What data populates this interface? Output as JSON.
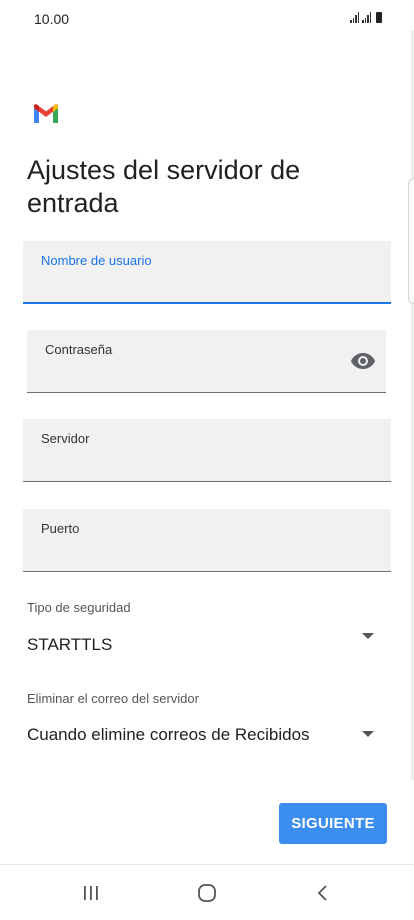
{
  "status_bar": {
    "time": "10.00"
  },
  "page": {
    "title": "Ajustes del servidor de entrada"
  },
  "fields": {
    "username": {
      "label": "Nombre de usuario",
      "value": ""
    },
    "password": {
      "label": "Contraseña",
      "value": ""
    },
    "server": {
      "label": "Servidor",
      "value": ""
    },
    "port": {
      "label": "Puerto",
      "value": ""
    }
  },
  "security": {
    "label": "Tipo de seguridad",
    "value": "STARTTLS"
  },
  "delete_mail": {
    "label": "Eliminar el correo del servidor",
    "value": "Cuando elimine correos de Recibidos"
  },
  "next_button": {
    "label": "SIGUIENTE"
  },
  "icons": {
    "logo": "gmail-logo",
    "password_toggle": "eye-icon",
    "nav_recents": "recents-icon",
    "nav_home": "home-icon",
    "nav_back": "back-icon"
  },
  "colors": {
    "accent": "#1a73e8",
    "button": "#3b8ef0",
    "field_bg": "#f1f1f1"
  }
}
